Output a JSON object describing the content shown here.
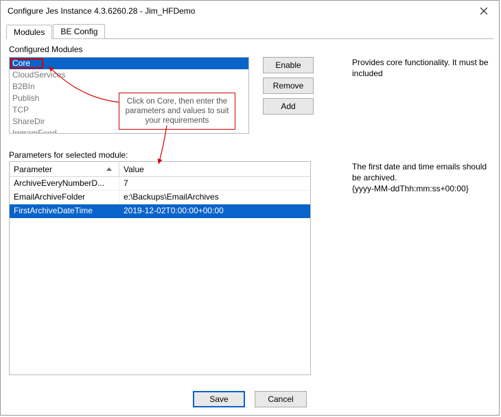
{
  "title": "Configure Jes Instance 4.3.6260.28 - Jim_HFDemo",
  "tabs": {
    "modules": "Modules",
    "be_config": "BE Config"
  },
  "configured_modules_label": "Configured Modules",
  "modules": [
    {
      "name": "Core",
      "selected": true
    },
    {
      "name": "CloudServices",
      "selected": false
    },
    {
      "name": "B2BIn",
      "selected": false
    },
    {
      "name": "Publish",
      "selected": false
    },
    {
      "name": "TCP",
      "selected": false
    },
    {
      "name": "ShareDir",
      "selected": false
    },
    {
      "name": "IngramFeed",
      "selected": false
    }
  ],
  "buttons": {
    "enable": "Enable",
    "remove": "Remove",
    "add": "Add",
    "save": "Save",
    "cancel": "Cancel"
  },
  "module_desc": "Provides core functionality.  It must be included",
  "callout": "Click on Core, then enter the parameters and values to suit your requirements",
  "params_label": "Parameters for selected module:",
  "grid_headers": {
    "parameter": "Parameter",
    "value": "Value"
  },
  "params": [
    {
      "name": "ArchiveEveryNumberD...",
      "value": "7",
      "selected": false
    },
    {
      "name": "EmailArchiveFolder",
      "value": "e:\\Backups\\EmailArchives",
      "selected": false
    },
    {
      "name": "FirstArchiveDateTime",
      "value": "2019-12-02T0:00:00+00:00",
      "selected": true
    }
  ],
  "param_desc_line1": "The first date and time emails should be archived.",
  "param_desc_line2": "{yyyy-MM-ddThh:mm:ss+00:00}"
}
